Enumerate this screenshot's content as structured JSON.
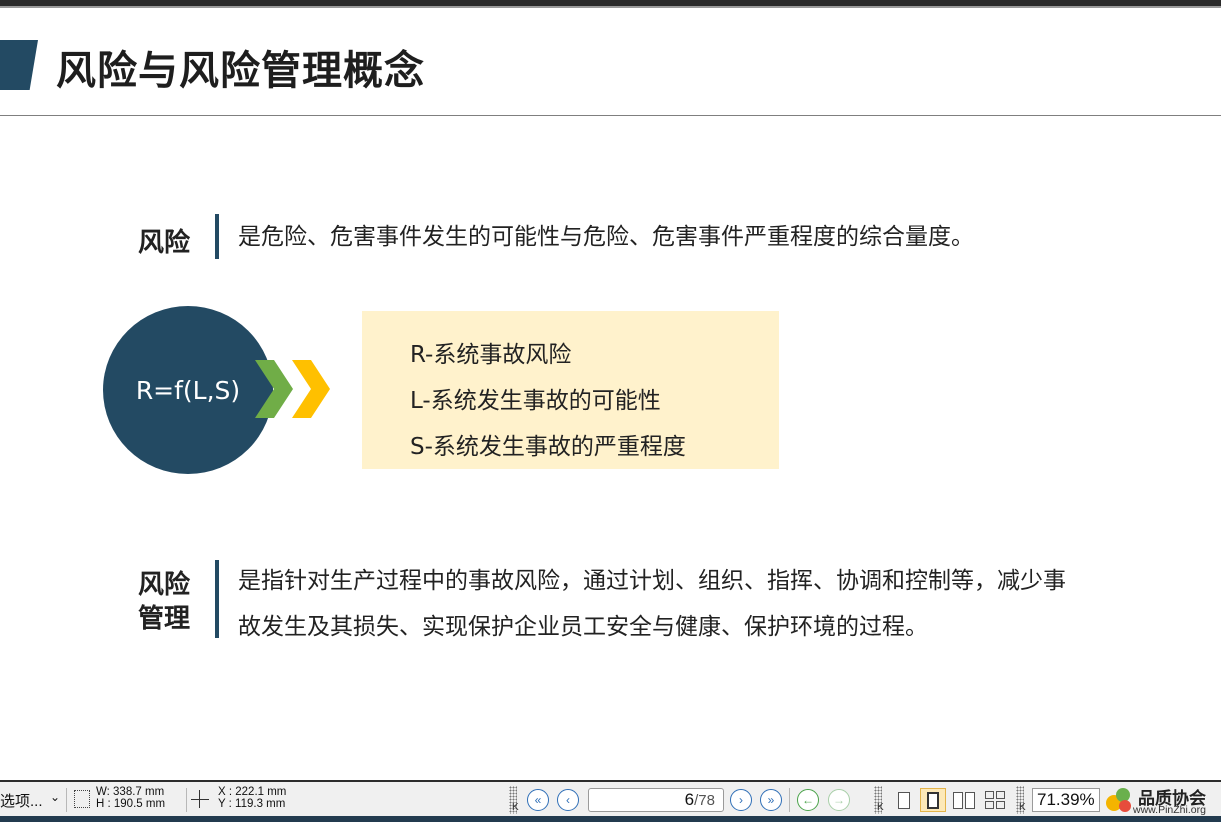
{
  "slide": {
    "title": "风险与风险管理概念",
    "risk": {
      "term": "风险",
      "definition": "是危险、危害事件发生的可能性与危险、危害事件严重程度的综合量度。"
    },
    "formula": {
      "text": "R=f(L,S)",
      "lines": [
        "R-系统事故风险",
        "L-系统发生事故的可能性",
        "S-系统发生事故的严重程度"
      ]
    },
    "risk_management": {
      "term_line1": "风险",
      "term_line2": "管理",
      "definition_line1": "是指针对生产过程中的事故风险，通过计划、组织、指挥、协调和控制等，减少事",
      "definition_line2": "故发生及其损失、实现保护企业员工安全与健康、保护环境的过程。"
    },
    "colors": {
      "accent": "#234a63",
      "chevron_green": "#70ad47",
      "chevron_yellow": "#ffc000",
      "legend_bg": "#fff2cc"
    }
  },
  "statusbar": {
    "options_label": "选项...",
    "width_label": "W: 338.7 mm",
    "height_label": "H : 190.5 mm",
    "x_label": "X : 222.1 mm",
    "y_label": "Y : 119.3 mm",
    "page_current": "6",
    "page_total": "/78",
    "zoom": "71.39%",
    "brand_name": "品质协会",
    "brand_url": "www.PinZhi.org",
    "icons": [
      "first-page-icon",
      "prev-page-icon",
      "next-page-icon",
      "last-page-icon",
      "back-icon",
      "forward-icon",
      "single-page-icon",
      "fit-page-icon",
      "two-page-icon",
      "grid-view-icon"
    ]
  }
}
